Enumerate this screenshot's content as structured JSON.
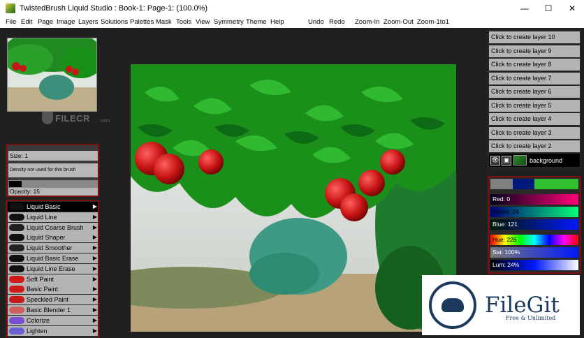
{
  "window": {
    "title": "TwistedBrush Liquid Studio : Book-1: Page-1:  (100.0%)",
    "controls": [
      "—",
      "☐",
      "✕"
    ]
  },
  "menu": {
    "items": [
      "File",
      "Edit",
      "Page",
      "Image",
      "Layers",
      "Solutions",
      "Palettes",
      "Mask",
      "Tools",
      "View",
      "Symmetry",
      "Theme",
      "Help"
    ],
    "actions": [
      "Undo",
      "Redo",
      "Zoom-In",
      "Zoom-Out",
      "Zoom-1to1"
    ]
  },
  "watermark": {
    "text": "FILECR",
    "sub": ".com"
  },
  "brush_settings": {
    "size": "Size: 1",
    "density": "Density not used for this brush",
    "opacity": "Opacity: 15",
    "color": "#000000"
  },
  "brushes": [
    {
      "label": "Liquid Basic",
      "selected": true,
      "thumb": "#111111"
    },
    {
      "label": "Liquid Line",
      "selected": false,
      "thumb": "#111111"
    },
    {
      "label": "Liquid Coarse Brush",
      "selected": false,
      "thumb": "#222222"
    },
    {
      "label": "Liquid Shaper",
      "selected": false,
      "thumb": "#111111"
    },
    {
      "label": "Liquid Smoother",
      "selected": false,
      "thumb": "#222222"
    },
    {
      "label": "Liquid Basic Erase",
      "selected": false,
      "thumb": "#111111"
    },
    {
      "label": "Liquid Line Erase",
      "selected": false,
      "thumb": "#111111"
    },
    {
      "label": "Soft Paint",
      "selected": false,
      "thumb": "#d01818"
    },
    {
      "label": "Basic Paint",
      "selected": false,
      "thumb": "#d01818"
    },
    {
      "label": "Speckled Paint",
      "selected": false,
      "thumb": "#c41a1a"
    },
    {
      "label": "Basic Blender 1",
      "selected": false,
      "thumb": "#d06060"
    },
    {
      "label": "Colorize",
      "selected": false,
      "thumb": "#7a4fcf"
    },
    {
      "label": "Lighten",
      "selected": false,
      "thumb": "#6a5fd0"
    }
  ],
  "layers": [
    "Click to create layer 10",
    "Click to create layer 9",
    "Click to create layer 8",
    "Click to create layer 7",
    "Click to create layer 6",
    "Click to create layer 5",
    "Click to create layer 4",
    "Click to create layer 3",
    "Click to create layer 2"
  ],
  "background_layer": {
    "label": "background",
    "eye_icon": "eye-icon",
    "lock_icon": "lock-icon"
  },
  "color": {
    "swatches": [
      "#808080",
      "#00187a",
      "#30c030",
      "#30c030"
    ],
    "red": "Red: 0",
    "green": "Green: 24",
    "blue": "Blue: 121",
    "hue": "Hue: 228",
    "sat": "Sat: 100%",
    "lum": "Lum: 24%"
  },
  "badge": {
    "name": "FileGit",
    "tagline": "Free & Unlimited"
  }
}
